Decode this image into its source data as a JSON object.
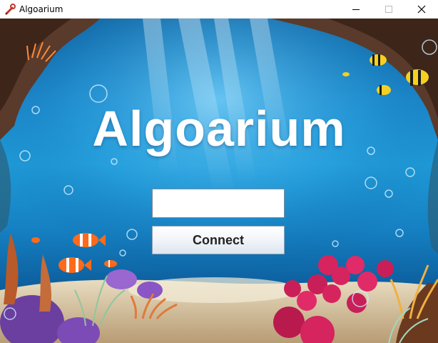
{
  "window": {
    "title": "Algoarium",
    "icon": "red-wrench-icon",
    "controls": {
      "minimize_icon": "minimize-icon",
      "maximize_icon": "maximize-icon",
      "close_icon": "close-icon"
    }
  },
  "main": {
    "logo_text": "Algoarium",
    "input": {
      "value": "",
      "placeholder": ""
    },
    "connect_label": "Connect"
  },
  "colors": {
    "logo": "#ffffff",
    "water_top": "#0e5f9e",
    "water_mid": "#1f9ad8",
    "button_text": "#222222"
  }
}
